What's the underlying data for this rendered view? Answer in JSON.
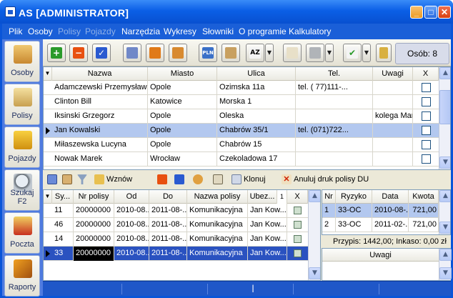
{
  "window": {
    "title": "AS [ADMINISTRATOR]",
    "minimize": "_",
    "maximize": "□",
    "close": "✕"
  },
  "menu": [
    {
      "label": "Plik",
      "enabled": true
    },
    {
      "label": "Osoby",
      "enabled": true
    },
    {
      "label": "Polisy",
      "enabled": false
    },
    {
      "label": "Pojazdy",
      "enabled": false
    },
    {
      "label": "Narzędzia",
      "enabled": true
    },
    {
      "label": "Wykresy",
      "enabled": true
    },
    {
      "label": "Słowniki",
      "enabled": true
    },
    {
      "label": "O programie",
      "enabled": true
    },
    {
      "label": "Kalkulatory",
      "enabled": true
    }
  ],
  "sidebar": [
    "Osoby",
    "Polisy",
    "Pojazdy",
    "Szukaj F2",
    "Poczta",
    "Raporty"
  ],
  "toolbar": {
    "counter": "Osób: 8"
  },
  "persons": {
    "columns": [
      "Nazwa",
      "Miasto",
      "Ulica",
      "Tel.",
      "Uwagi",
      "X"
    ],
    "rows": [
      {
        "nazwa": "Adamczewski Przemysław",
        "miasto": "Opole",
        "ulica": "Ozimska 11a",
        "tel": "tel. ( 77)111-...",
        "uwagi": ""
      },
      {
        "nazwa": "Clinton Bill",
        "miasto": "Katowice",
        "ulica": "Morska 1",
        "tel": "",
        "uwagi": ""
      },
      {
        "nazwa": "Iksinski Grzegorz",
        "miasto": "Opole",
        "ulica": "Oleska",
        "tel": "",
        "uwagi": "kolega Marka"
      },
      {
        "nazwa": "Jan Kowalski",
        "miasto": "Opole",
        "ulica": "Chabrów 35/1",
        "tel": "tel. (071)722...",
        "uwagi": ""
      },
      {
        "nazwa": "Miłaszewska Lucyna",
        "miasto": "Opole",
        "ulica": "Chabrów 15",
        "tel": "",
        "uwagi": ""
      },
      {
        "nazwa": "Nowak Marek",
        "miasto": "Wrocław",
        "ulica": "Czekoladowa 17",
        "tel": "",
        "uwagi": ""
      }
    ],
    "selected_index": 3
  },
  "policy_toolbar": {
    "wznow": "Wznów",
    "klonuj": "Klonuj",
    "anuluj": "Anuluj druk polisy DU"
  },
  "policies": {
    "columns": [
      "Sy...",
      "Nr polisy",
      "Od",
      "Do",
      "Nazwa polisy",
      "Ubez...",
      "1",
      "X"
    ],
    "rows": [
      {
        "sy": "11",
        "nr": "20000000",
        "od": "2010-08...",
        "do": "2011-08-...",
        "nazwa": "Komunikacyjna",
        "ubez": "Jan Kow..."
      },
      {
        "sy": "46",
        "nr": "20000000",
        "od": "2010-08...",
        "do": "2011-08-...",
        "nazwa": "Komunikacyjna",
        "ubez": "Jan Kow..."
      },
      {
        "sy": "14",
        "nr": "20000000",
        "od": "2010-08...",
        "do": "2011-08-...",
        "nazwa": "Komunikacyjna",
        "ubez": "Jan Kow..."
      },
      {
        "sy": "33",
        "nr": "20000000",
        "od": "2010-08...",
        "do": "2011-08-...",
        "nazwa": "Komunikacyjna",
        "ubez": "Jan Kow..."
      }
    ],
    "selected_index": 3
  },
  "installments": {
    "columns": [
      "Nr",
      "Ryzyko",
      "Data",
      "Kwota"
    ],
    "rows": [
      {
        "nr": "1",
        "ryzyko": "33-OC",
        "data": "2010-08-...",
        "kwota": "721,00"
      },
      {
        "nr": "2",
        "ryzyko": "33-OC",
        "data": "2011-02-...",
        "kwota": "721,00"
      }
    ],
    "summary": "Przypis: 1442,00; Inkaso: 0,00 zł",
    "notes_header": "Uwagi"
  }
}
